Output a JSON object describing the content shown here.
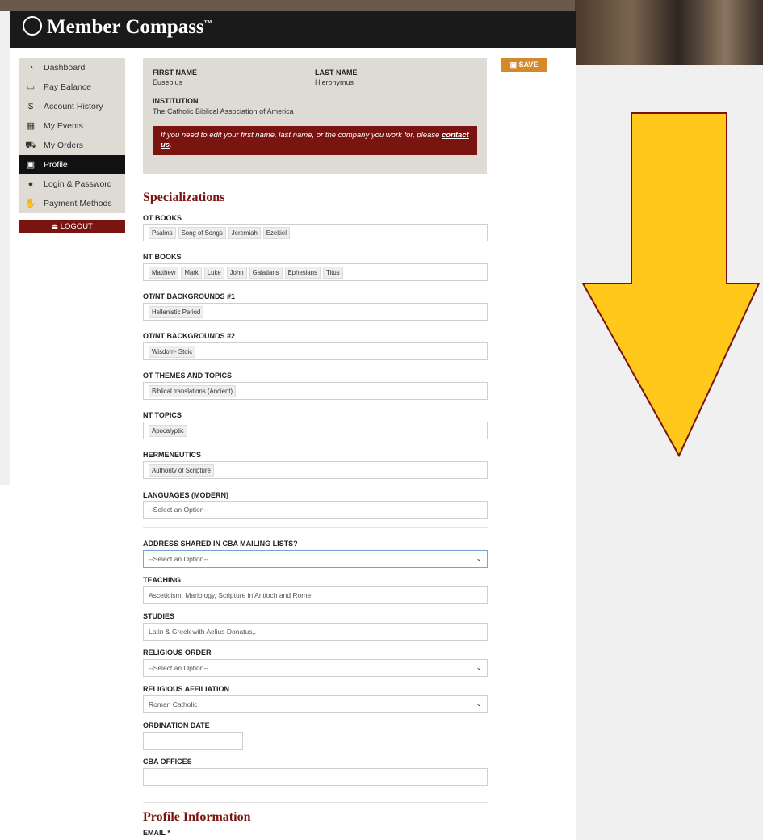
{
  "app": {
    "title": "Member Compass",
    "trademark": "™"
  },
  "sidebar": {
    "items": [
      {
        "label": "Dashboard",
        "icon": "dashboard-icon"
      },
      {
        "label": "Pay Balance",
        "icon": "card-icon"
      },
      {
        "label": "Account History",
        "icon": "dollar-icon"
      },
      {
        "label": "My Events",
        "icon": "calendar-icon"
      },
      {
        "label": "My Orders",
        "icon": "cart-icon"
      },
      {
        "label": "Profile",
        "icon": "id-card-icon"
      },
      {
        "label": "Login & Password",
        "icon": "users-icon"
      },
      {
        "label": "Payment Methods",
        "icon": "hand-money-icon"
      }
    ],
    "active": "Profile",
    "logout_label": "LOGOUT"
  },
  "save_label": "SAVE",
  "name_box": {
    "first_name_label": "FIRST NAME",
    "first_name": "Eusebius",
    "last_name_label": "LAST NAME",
    "last_name": "Hieronymus",
    "institution_label": "INSTITUTION",
    "institution": "The Catholic Biblical Association of America",
    "notice": "If you need to edit your first name, last name, or the company you work for, please",
    "notice_link": "contact us",
    "notice_end": "."
  },
  "specializations": {
    "title": "Specializations",
    "ot_books_label": "OT BOOKS",
    "ot_books": [
      "Psalms",
      "Song of Songs",
      "Jeremiah",
      "Ezekiel"
    ],
    "nt_books_label": "NT BOOKS",
    "nt_books": [
      "Matthew",
      "Mark",
      "Luke",
      "John",
      "Galatians",
      "Ephesians",
      "Titus"
    ],
    "bg1_label": "OT/NT BACKGROUNDS #1",
    "bg1": [
      "Hellenistic Period"
    ],
    "bg2_label": "OT/NT BACKGROUNDS #2",
    "bg2": [
      "Wisdom- Stoic"
    ],
    "ot_themes_label": "OT THEMES AND TOPICS",
    "ot_themes": [
      "Biblical translations (Ancient)"
    ],
    "nt_topics_label": "NT TOPICS",
    "nt_topics": [
      "Apocalyptic"
    ],
    "hermeneutics_label": "HERMENEUTICS",
    "hermeneutics": [
      "Authority of Scripture"
    ],
    "languages_label": "LANGUAGES (MODERN)",
    "languages_placeholder": "--Select an Option--"
  },
  "other": {
    "address_label": "ADDRESS SHARED IN CBA MAILING LISTS?",
    "address_value": "--Select an Option--",
    "teaching_label": "TEACHING",
    "teaching_value": "Asceticism, Mariology, Scripture in Antioch and Rome",
    "studies_label": "STUDIES",
    "studies_value": "Latin & Greek with Aelius Donatus,.",
    "religious_order_label": "RELIGIOUS ORDER",
    "religious_order_value": "--Select an Option--",
    "religious_affiliation_label": "RELIGIOUS AFFILIATION",
    "religious_affiliation_value": "Roman Catholic",
    "ordination_label": "ORDINATION DATE",
    "cba_offices_label": "CBA OFFICES"
  },
  "profile_info": {
    "title": "Profile Information",
    "email_label": "EMAIL *"
  },
  "colors": {
    "maroon": "#7a1410",
    "save": "#d4892a",
    "arrow_fill": "#ffc81a",
    "arrow_stroke": "#7a1410"
  }
}
